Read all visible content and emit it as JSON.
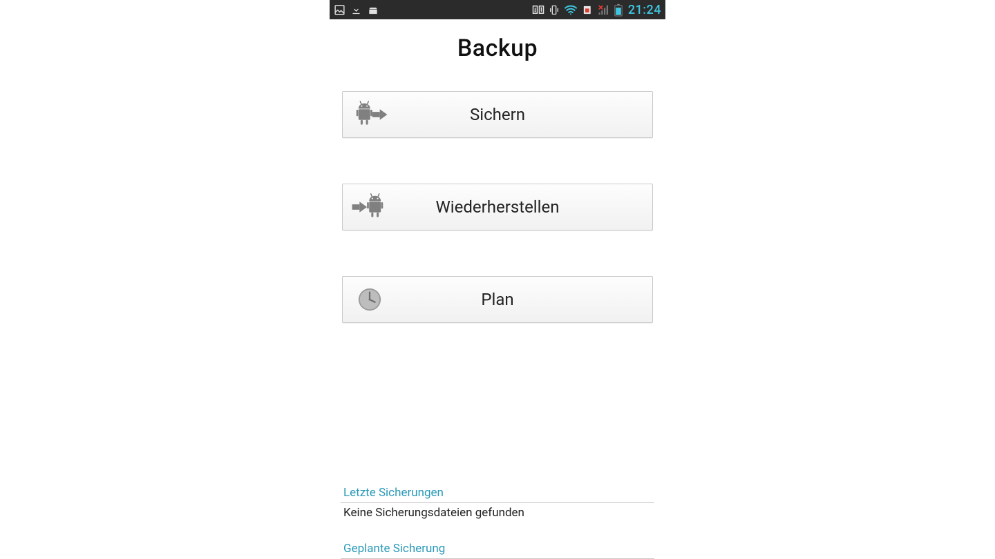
{
  "statusbar": {
    "clock": "21:24"
  },
  "header": {
    "title": "Backup"
  },
  "buttons": {
    "backup_label": "Sichern",
    "restore_label": "Wiederherstellen",
    "plan_label": "Plan"
  },
  "sections": {
    "last_backups_header": "Letzte Sicherungen",
    "last_backups_body": "Keine Sicherungsdateien gefunden",
    "scheduled_header": "Geplante Sicherung"
  },
  "colors": {
    "accent": "#2a99b8",
    "status_accent": "#3ec6e0",
    "button_border": "#c9c9c9"
  }
}
